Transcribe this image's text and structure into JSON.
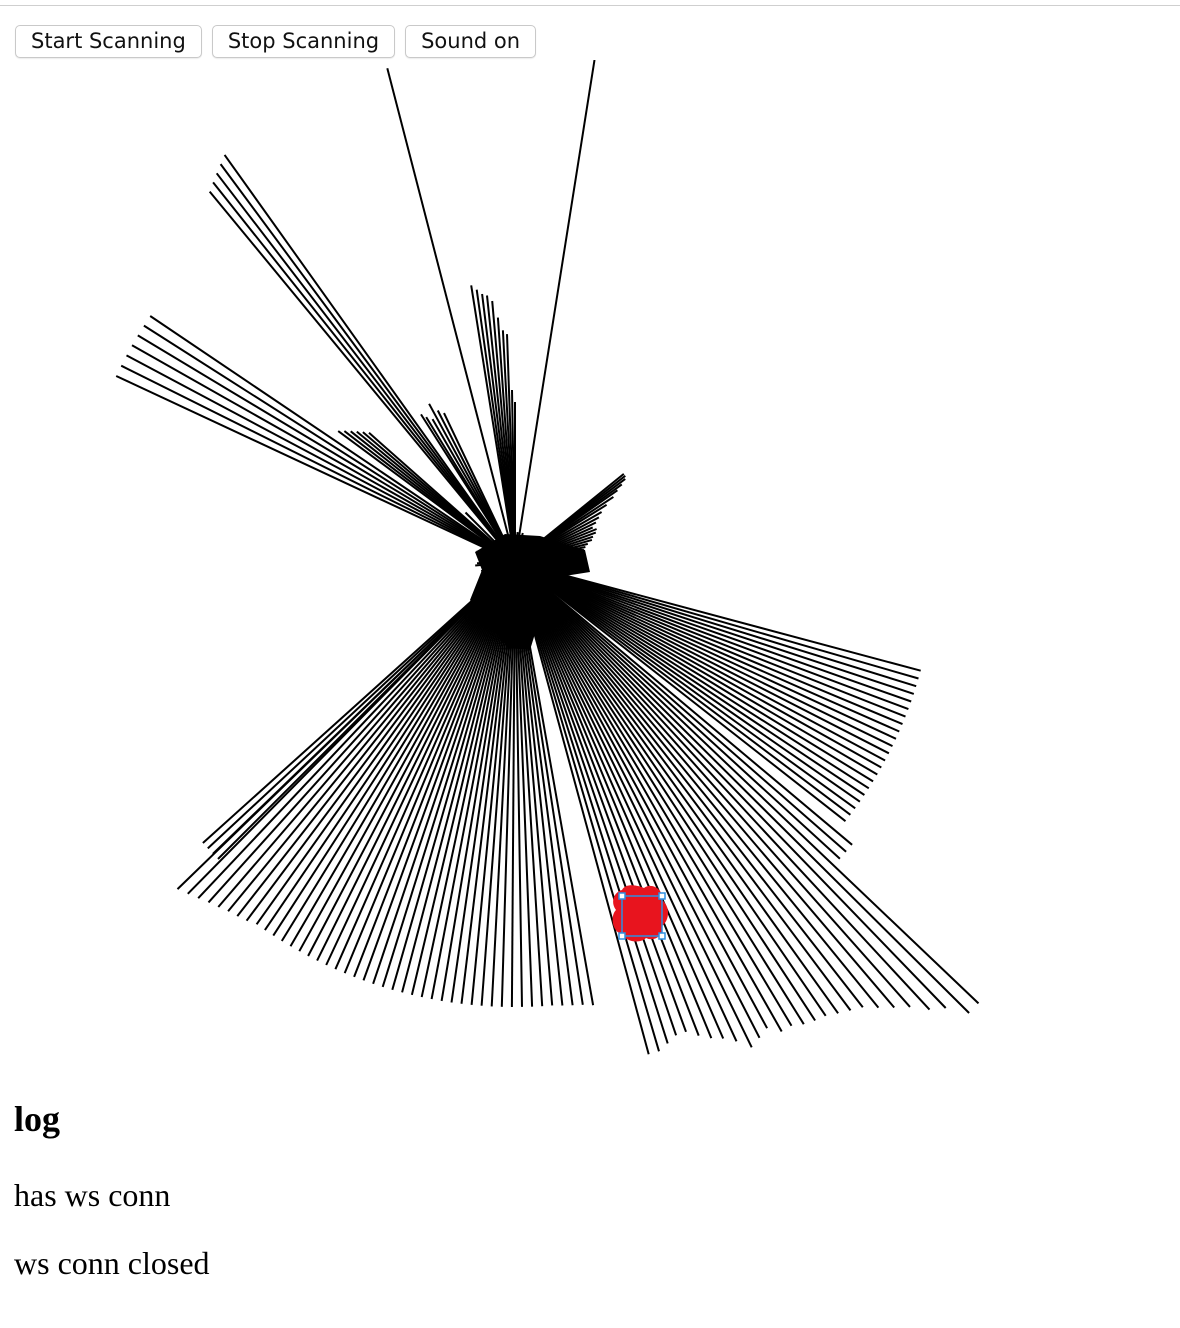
{
  "toolbar": {
    "start_label": "Start Scanning",
    "stop_label": "Stop Scanning",
    "sound_label": "Sound on"
  },
  "scan": {
    "scan_dot_color": "#e8141e",
    "selection_handle_color": "#2d8fe0",
    "rays": [
      {
        "a": -146.0,
        "r": 440
      },
      {
        "a": -147.5,
        "r": 440
      },
      {
        "a": -149.0,
        "r": 440
      },
      {
        "a": -150.5,
        "r": 440
      },
      {
        "a": -152.0,
        "r": 440
      },
      {
        "a": -153.5,
        "r": 440
      },
      {
        "a": -155.0,
        "r": 440
      },
      {
        "a": -143.5,
        "r": 220
      },
      {
        "a": -142.5,
        "r": 215
      },
      {
        "a": -141.5,
        "r": 210
      },
      {
        "a": -140.5,
        "r": 205
      },
      {
        "a": -139.5,
        "r": 200
      },
      {
        "a": -138.5,
        "r": 195
      },
      {
        "a": -129.5,
        "r": 480
      },
      {
        "a": -128.5,
        "r": 485
      },
      {
        "a": -127.5,
        "r": 490
      },
      {
        "a": -126.5,
        "r": 495
      },
      {
        "a": -125.5,
        "r": 500
      },
      {
        "a": -122.5,
        "r": 175
      },
      {
        "a": -121.5,
        "r": 170
      },
      {
        "a": -120.0,
        "r": 165
      },
      {
        "a": -118.5,
        "r": 180
      },
      {
        "a": -117.0,
        "r": 170
      },
      {
        "a": -115.5,
        "r": 165
      },
      {
        "a": -104.5,
        "r": 510
      },
      {
        "a": -99.0,
        "r": 280
      },
      {
        "a": -98.0,
        "r": 275
      },
      {
        "a": -97.0,
        "r": 270
      },
      {
        "a": -96.0,
        "r": 268
      },
      {
        "a": -95.0,
        "r": 262
      },
      {
        "a": -94.0,
        "r": 245
      },
      {
        "a": -93.0,
        "r": 232
      },
      {
        "a": -92.0,
        "r": 228
      },
      {
        "a": -91.0,
        "r": 172
      },
      {
        "a": -90.0,
        "r": 160
      },
      {
        "a": -81.0,
        "r": 510
      },
      {
        "a": -140.0,
        "r": 80
      },
      {
        "a": -135.0,
        "r": 70
      },
      {
        "a": -165.0,
        "r": 40
      },
      {
        "a": -158.0,
        "r": 35
      },
      {
        "a": -168.0,
        "r": 30
      },
      {
        "a": 170.0,
        "r": 30
      },
      {
        "a": 175.0,
        "r": 40
      },
      {
        "a": 178.0,
        "r": 38
      },
      {
        "a": 150.0,
        "r": 30
      },
      {
        "a": 165.0,
        "r": 35
      },
      {
        "a": -39.0,
        "r": 140
      },
      {
        "a": -38.0,
        "r": 140
      },
      {
        "a": -37.0,
        "r": 138
      },
      {
        "a": -36.0,
        "r": 132
      },
      {
        "a": -35.0,
        "r": 125
      },
      {
        "a": -33.5,
        "r": 118
      },
      {
        "a": -32.0,
        "r": 108
      },
      {
        "a": -30.0,
        "r": 100
      },
      {
        "a": -28.0,
        "r": 95
      },
      {
        "a": -26.0,
        "r": 90
      },
      {
        "a": -24.0,
        "r": 85
      },
      {
        "a": -22.0,
        "r": 88
      },
      {
        "a": -20.0,
        "r": 86
      },
      {
        "a": -18.0,
        "r": 82
      },
      {
        "a": -16.0,
        "r": 80
      },
      {
        "a": -14.0,
        "r": 75
      },
      {
        "a": -12.0,
        "r": 72
      },
      {
        "a": -10.0,
        "r": 70
      },
      {
        "a": -8.0,
        "r": 68
      },
      {
        "a": -6.0,
        "r": 66
      },
      {
        "a": -4.0,
        "r": 64
      },
      {
        "a": -2.0,
        "r": 65
      },
      {
        "a": 0.0,
        "r": 66
      },
      {
        "a": 2.0,
        "r": 64
      },
      {
        "a": 4.0,
        "r": 62
      },
      {
        "a": 6.0,
        "r": 60
      },
      {
        "a": 8.0,
        "r": 58
      },
      {
        "a": 10.0,
        "r": 55
      },
      {
        "a": -85.0,
        "r": 30
      },
      {
        "a": -75.0,
        "r": 30
      },
      {
        "a": -70.0,
        "r": 28
      },
      {
        "a": -60.0,
        "r": 30
      },
      {
        "a": 15.0,
        "r": 420
      },
      {
        "a": 16.1,
        "r": 420
      },
      {
        "a": 17.2,
        "r": 420
      },
      {
        "a": 18.3,
        "r": 420
      },
      {
        "a": 19.4,
        "r": 420
      },
      {
        "a": 20.5,
        "r": 420
      },
      {
        "a": 21.6,
        "r": 420
      },
      {
        "a": 22.7,
        "r": 420
      },
      {
        "a": 23.8,
        "r": 420
      },
      {
        "a": 24.9,
        "r": 420
      },
      {
        "a": 26.0,
        "r": 420
      },
      {
        "a": 27.1,
        "r": 420
      },
      {
        "a": 28.2,
        "r": 420
      },
      {
        "a": 29.3,
        "r": 420
      },
      {
        "a": 30.4,
        "r": 420
      },
      {
        "a": 31.5,
        "r": 420
      },
      {
        "a": 32.6,
        "r": 420
      },
      {
        "a": 33.7,
        "r": 420
      },
      {
        "a": 34.8,
        "r": 420
      },
      {
        "a": 35.9,
        "r": 420
      },
      {
        "a": 37.0,
        "r": 420
      },
      {
        "a": 38.1,
        "r": 420
      },
      {
        "a": 40.0,
        "r": 440
      },
      {
        "a": 41.2,
        "r": 440
      },
      {
        "a": 42.4,
        "r": 440
      },
      {
        "a": 43.6,
        "r": 640
      },
      {
        "a": 44.8,
        "r": 640
      },
      {
        "a": 46.0,
        "r": 620
      },
      {
        "a": 47.2,
        "r": 610
      },
      {
        "a": 48.4,
        "r": 595
      },
      {
        "a": 49.6,
        "r": 585
      },
      {
        "a": 50.8,
        "r": 575
      },
      {
        "a": 52.0,
        "r": 565
      },
      {
        "a": 53.2,
        "r": 560
      },
      {
        "a": 54.4,
        "r": 555
      },
      {
        "a": 55.6,
        "r": 550
      },
      {
        "a": 56.8,
        "r": 548
      },
      {
        "a": 58.0,
        "r": 545
      },
      {
        "a": 59.2,
        "r": 540
      },
      {
        "a": 60.4,
        "r": 540
      },
      {
        "a": 61.6,
        "r": 530
      },
      {
        "a": 62.8,
        "r": 535
      },
      {
        "a": 64.0,
        "r": 540
      },
      {
        "a": 65.2,
        "r": 528
      },
      {
        "a": 66.4,
        "r": 520
      },
      {
        "a": 67.6,
        "r": 515
      },
      {
        "a": 68.8,
        "r": 508
      },
      {
        "a": 70.0,
        "r": 500
      },
      {
        "a": 71.2,
        "r": 500
      },
      {
        "a": 72.4,
        "r": 505
      },
      {
        "a": 73.6,
        "r": 510
      },
      {
        "a": 74.8,
        "r": 510
      },
      {
        "a": 80.0,
        "r": 450
      },
      {
        "a": 81.3,
        "r": 448
      },
      {
        "a": 82.6,
        "r": 447
      },
      {
        "a": 83.9,
        "r": 446
      },
      {
        "a": 85.2,
        "r": 445
      },
      {
        "a": 86.5,
        "r": 445
      },
      {
        "a": 87.8,
        "r": 445
      },
      {
        "a": 89.1,
        "r": 445
      },
      {
        "a": 90.4,
        "r": 445
      },
      {
        "a": 91.7,
        "r": 445
      },
      {
        "a": 93.0,
        "r": 445
      },
      {
        "a": 94.3,
        "r": 445
      },
      {
        "a": 95.6,
        "r": 445
      },
      {
        "a": 96.9,
        "r": 445
      },
      {
        "a": 98.2,
        "r": 445
      },
      {
        "a": 99.5,
        "r": 445
      },
      {
        "a": 100.8,
        "r": 445
      },
      {
        "a": 102.1,
        "r": 445
      },
      {
        "a": 103.4,
        "r": 445
      },
      {
        "a": 104.7,
        "r": 445
      },
      {
        "a": 106.0,
        "r": 445
      },
      {
        "a": 107.3,
        "r": 445
      },
      {
        "a": 108.6,
        "r": 445
      },
      {
        "a": 109.9,
        "r": 445
      },
      {
        "a": 111.2,
        "r": 445
      },
      {
        "a": 112.5,
        "r": 445
      },
      {
        "a": 113.8,
        "r": 445
      },
      {
        "a": 115.1,
        "r": 445
      },
      {
        "a": 116.4,
        "r": 445
      },
      {
        "a": 117.7,
        "r": 445
      },
      {
        "a": 119.0,
        "r": 445
      },
      {
        "a": 120.3,
        "r": 445
      },
      {
        "a": 121.6,
        "r": 445
      },
      {
        "a": 122.9,
        "r": 445
      },
      {
        "a": 124.2,
        "r": 445
      },
      {
        "a": 125.5,
        "r": 445
      },
      {
        "a": 126.8,
        "r": 448
      },
      {
        "a": 128.1,
        "r": 450
      },
      {
        "a": 129.4,
        "r": 452
      },
      {
        "a": 130.7,
        "r": 455
      },
      {
        "a": 132.0,
        "r": 458
      },
      {
        "a": 133.3,
        "r": 462
      },
      {
        "a": 134.6,
        "r": 466
      },
      {
        "a": 135.9,
        "r": 470
      },
      {
        "a": 135.0,
        "r": 420
      },
      {
        "a": 136.0,
        "r": 420
      },
      {
        "a": 137.0,
        "r": 420
      },
      {
        "a": 138.0,
        "r": 420
      }
    ]
  },
  "log": {
    "title": "log",
    "lines": [
      "has ws conn",
      "ws conn closed"
    ]
  }
}
